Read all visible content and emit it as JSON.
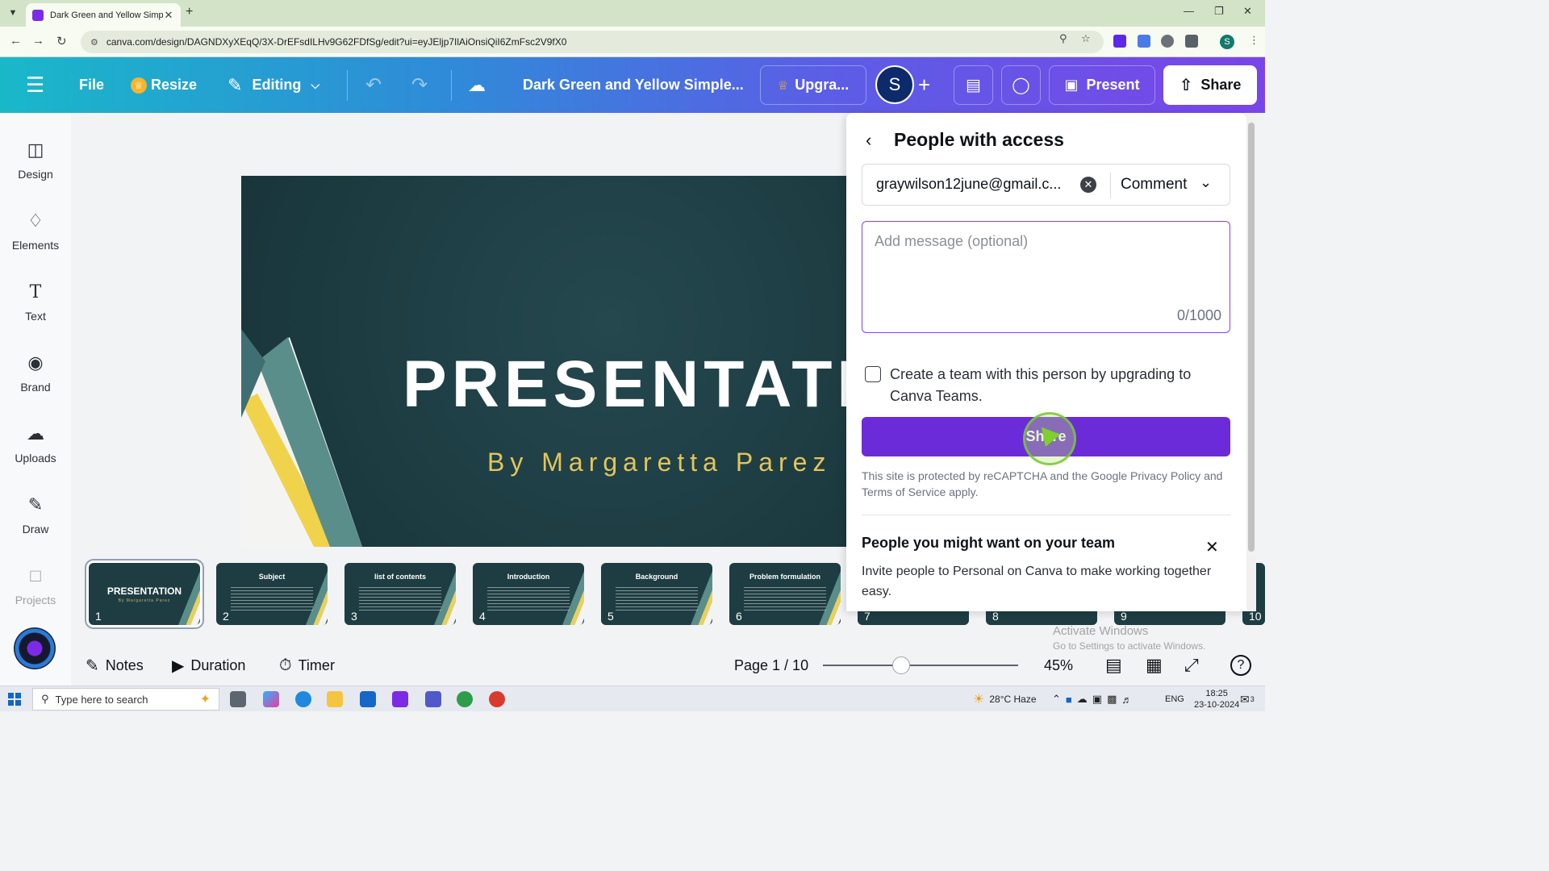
{
  "browser": {
    "tab_title": "Dark Green and Yellow Simple I",
    "url": "canva.com/design/DAGNDXyXEqQ/3X-DrEFsdILHv9G62FDfSg/edit?ui=eyJEljp7IlAiOnsiQiI6ZmFsc2V9fX0",
    "profile_initial": "S"
  },
  "toolbar": {
    "file": "File",
    "resize": "Resize",
    "editing": "Editing",
    "doc_title": "Dark Green and Yellow Simple...",
    "upgrade": "Upgra...",
    "avatar_initial": "S",
    "present": "Present",
    "share": "Share"
  },
  "sidebar": {
    "items": [
      {
        "label": "Design",
        "icon": "design-icon"
      },
      {
        "label": "Elements",
        "icon": "elements-icon"
      },
      {
        "label": "Text",
        "icon": "text-icon"
      },
      {
        "label": "Brand",
        "icon": "brand-icon"
      },
      {
        "label": "Uploads",
        "icon": "uploads-icon"
      },
      {
        "label": "Draw",
        "icon": "draw-icon"
      },
      {
        "label": "Projects",
        "icon": "projects-icon"
      }
    ]
  },
  "slide": {
    "title": "PRESENTATIO",
    "subtitle": "By Margaretta Parez"
  },
  "thumbnails": [
    {
      "num": "1",
      "title": "PRESENTATION",
      "subtitle": "By Margaretta Parez"
    },
    {
      "num": "2",
      "title": "Subject"
    },
    {
      "num": "3",
      "title": "list of contents"
    },
    {
      "num": "4",
      "title": "Introduction"
    },
    {
      "num": "5",
      "title": "Background"
    },
    {
      "num": "6",
      "title": "Problem formulation"
    },
    {
      "num": "7",
      "title": ""
    },
    {
      "num": "8",
      "title": ""
    },
    {
      "num": "9",
      "title": ""
    },
    {
      "num": "10",
      "title": ""
    }
  ],
  "bottombar": {
    "notes": "Notes",
    "duration": "Duration",
    "timer": "Timer",
    "page": "Page 1 / 10",
    "zoom": "45%",
    "zoom_level": 0.4
  },
  "share_panel": {
    "title": "People with access",
    "email": "graywilson12june@gmail.c...",
    "role": "Comment",
    "message_placeholder": "Add message (optional)",
    "counter": "0/1000",
    "team_checkbox_label": "Create a team with this person by upgrading to Canva Teams.",
    "share_button": "Share",
    "recaptcha": "This site is protected by reCAPTCHA and the Google Privacy Policy and Terms of Service apply.",
    "suggest_title": "People you might want on your team",
    "suggest_desc": "Invite people to Personal on Canva to make working together easy."
  },
  "watermark": {
    "line1": "Activate Windows",
    "line2": "Go to Settings to activate Windows."
  },
  "taskbar": {
    "search_placeholder": "Type here to search",
    "weather": "28°C  Haze",
    "lang": "ENG",
    "time": "18:25",
    "date": "23-10-2024",
    "notif_count": "3"
  },
  "colors": {
    "accent": "#7d2ae8",
    "share_button": "#6c2bd9",
    "slide_bg": "#1b3a40",
    "slide_subtitle": "#e4c45a"
  }
}
